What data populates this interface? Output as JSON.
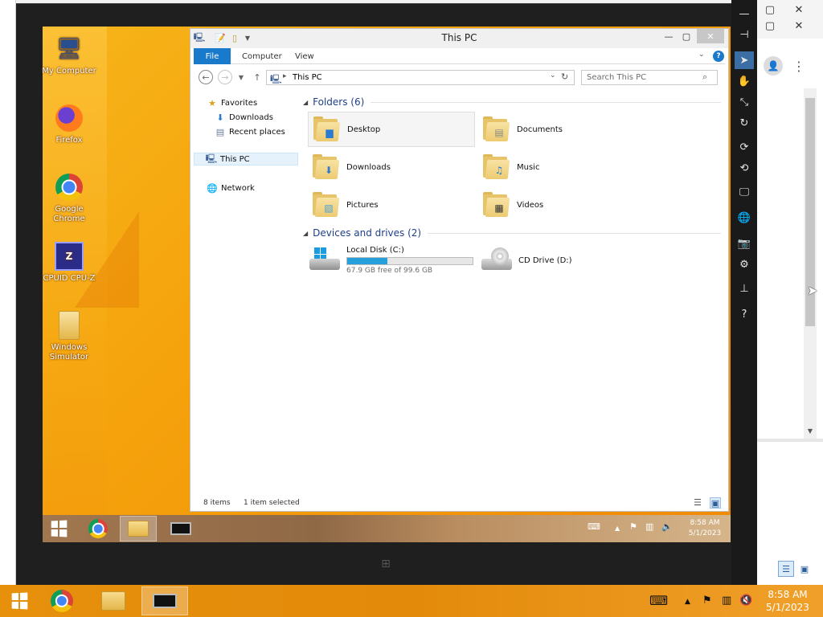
{
  "desktop_icons": [
    {
      "label": "My Computer",
      "icon": "computer-icon"
    },
    {
      "label": "Firefox",
      "icon": "firefox-icon"
    },
    {
      "label": "Google Chrome",
      "icon": "chrome-icon"
    },
    {
      "label": "CPUID CPU-Z",
      "icon": "cpuz-icon"
    },
    {
      "label": "Windows Simulator",
      "icon": "folder-icon"
    }
  ],
  "explorer": {
    "title": "This PC",
    "ribbon_tabs": [
      "File",
      "Computer",
      "View"
    ],
    "address": "This PC",
    "search_placeholder": "Search This PC",
    "nav": {
      "favorites": "Favorites",
      "downloads": "Downloads",
      "recent": "Recent places",
      "thispc": "This PC",
      "network": "Network"
    },
    "folders_header": "Folders (6)",
    "folders": [
      "Desktop",
      "Documents",
      "Downloads",
      "Music",
      "Pictures",
      "Videos"
    ],
    "devices_header": "Devices and drives (2)",
    "drives": [
      {
        "name": "Local Disk (C:)",
        "free": "67.9 GB free of 99.6 GB",
        "used_fraction": 0.318
      },
      {
        "name": "CD Drive (D:)"
      }
    ],
    "status": {
      "items": "8 items",
      "selected": "1 item selected"
    }
  },
  "vm_taskbar": {
    "time": "8:58 AM",
    "date": "5/1/2023"
  },
  "host_taskbar": {
    "time": "8:58 AM",
    "date": "5/1/2023"
  },
  "colors": {
    "accent": "#1979ca",
    "drive_bar": "#26a0da",
    "header_text": "#1e3f88"
  }
}
